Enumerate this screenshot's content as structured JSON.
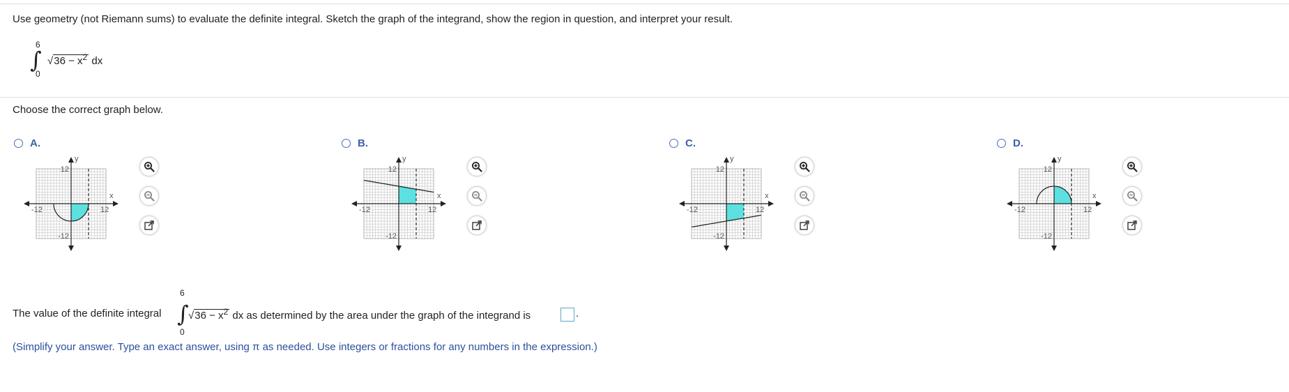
{
  "question": {
    "prompt": "Use geometry (not Riemann sums) to evaluate the definite integral. Sketch the graph of the integrand, show the region in question, and interpret your result.",
    "integral": {
      "upper": "6",
      "lower": "0",
      "integrand": "36 − x",
      "exponent": "2",
      "differential": "dx"
    }
  },
  "choose_prompt": "Choose the correct graph below.",
  "options": [
    {
      "letter": "A.",
      "graph": "lower-quarter-circle"
    },
    {
      "letter": "B.",
      "graph": "line-above"
    },
    {
      "letter": "C.",
      "graph": "line-below"
    },
    {
      "letter": "D.",
      "graph": "upper-quarter-circle"
    }
  ],
  "graph_labels": {
    "pos": "12",
    "neg": "-12",
    "x_axis": "x",
    "y_axis": "y"
  },
  "tools": [
    "zoom-in-icon",
    "zoom-out-icon",
    "popout-icon"
  ],
  "answer": {
    "prefix": "The value of the definite integral",
    "suffix": "as determined by the area under the graph of the integrand is",
    "period": ".",
    "value": "",
    "note": "(Simplify your answer. Type an exact answer, using π as needed. Use integers or fractions for any numbers in the expression.)"
  },
  "colors": {
    "fill": "#5ce0e0",
    "accent": "#3d5fa8",
    "grid": "#c8c8c8"
  }
}
